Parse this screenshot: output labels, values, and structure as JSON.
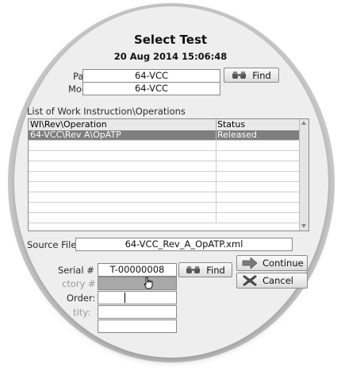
{
  "dialog": {
    "title": "Select Test",
    "datetime": "20 Aug 2014 15:06:48"
  },
  "part": {
    "label": "Part #",
    "value": "64-VCC",
    "find_label": "Find"
  },
  "model": {
    "label": "Model #",
    "value": "64-VCC"
  },
  "operations": {
    "section_label": "List of Work Instruction\\Operations",
    "columns": [
      "WI\\Rev\\Operation",
      "Status"
    ],
    "rows": [
      {
        "operation": "64-VCC\\Rev A\\OpATP",
        "status": "Released"
      }
    ],
    "selected_index": 0
  },
  "source_file": {
    "label": "Source File",
    "value": "64-VCC_Rev_A_OpATP.xml"
  },
  "serial": {
    "label": "Serial #",
    "value": "T-00000008",
    "find_label": "Find"
  },
  "factory": {
    "label": "ctory #",
    "value": ""
  },
  "order": {
    "label": "Order:",
    "value": ""
  },
  "quantity": {
    "label": "tity:",
    "value": ""
  },
  "actions": {
    "continue_label": "Continue",
    "cancel_label": "Cancel"
  },
  "colors": {
    "selected_row": "#7f7f7f",
    "field_disabled": "#a8a8a8",
    "continue_arrow": "#7a7a7a",
    "cancel_x": "#4a4a4a"
  },
  "icons": [
    "binoculars-icon",
    "arrow-right-icon",
    "close-x-icon",
    "mouse-cursor-icon",
    "scroll-up-icon",
    "scroll-down-icon"
  ]
}
